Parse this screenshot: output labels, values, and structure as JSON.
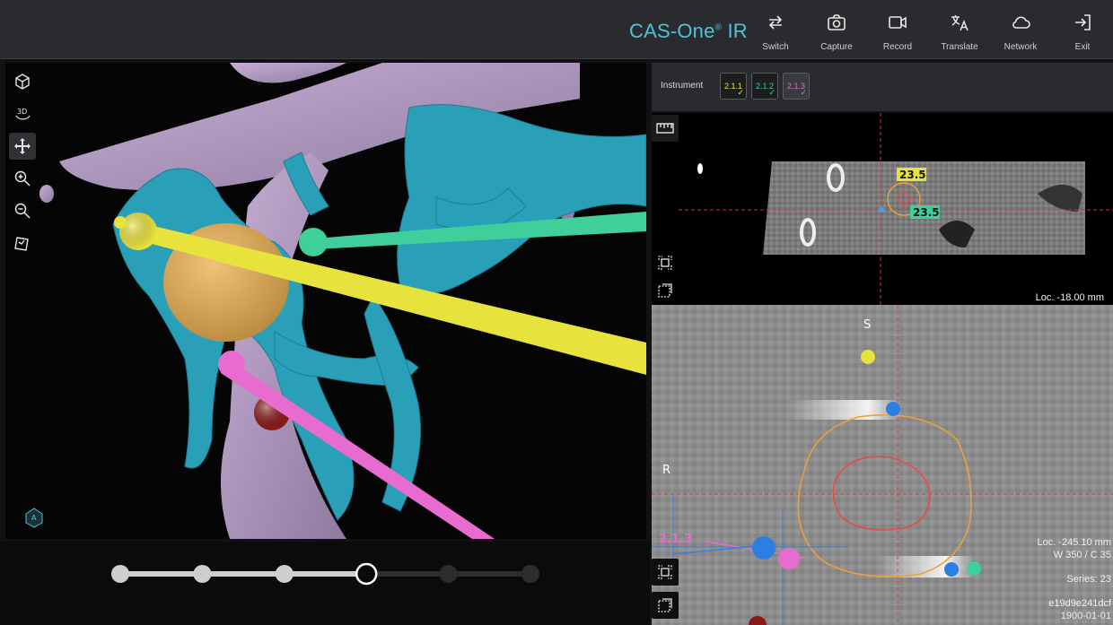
{
  "app": {
    "brand": "CAS-One",
    "brand_suffix": "IR",
    "brand_mark": "®"
  },
  "toolbar": [
    {
      "name": "switch",
      "label": "Switch",
      "icon": "switch-arrows-icon"
    },
    {
      "name": "capture",
      "label": "Capture",
      "icon": "camera-icon"
    },
    {
      "name": "record",
      "label": "Record",
      "icon": "video-camera-icon"
    },
    {
      "name": "translate",
      "label": "Translate",
      "icon": "translate-icon"
    },
    {
      "name": "network",
      "label": "Network",
      "icon": "cloud-icon"
    },
    {
      "name": "exit",
      "label": "Exit",
      "icon": "exit-door-icon"
    }
  ],
  "left_tools": [
    {
      "name": "reset-view",
      "icon": "cube-icon",
      "active": false
    },
    {
      "name": "3d-view",
      "label": "3D",
      "icon": "3d-rotate-icon",
      "active": false
    },
    {
      "name": "pan",
      "icon": "move-arrows-icon",
      "active": true
    },
    {
      "name": "zoom-in",
      "icon": "zoom-in-icon",
      "active": false
    },
    {
      "name": "zoom-out",
      "icon": "zoom-out-icon",
      "active": false
    },
    {
      "name": "screenshot",
      "icon": "snapshot-icon",
      "active": false
    }
  ],
  "timeline": {
    "steps": 6,
    "current_step": 4,
    "completed_steps": 3
  },
  "instrument": {
    "label": "Instrument",
    "items": [
      {
        "id": "2.1.1",
        "color": "#e8e23c",
        "checked": true
      },
      {
        "id": "2.1.2",
        "color": "#3fcf9a",
        "checked": true
      },
      {
        "id": "2.1.3",
        "color": "#e86cd0",
        "checked": true
      }
    ]
  },
  "axial": {
    "label_top": "23.5",
    "label_bottom": "23.5",
    "loc": "Loc. -18.00 mm"
  },
  "coronal": {
    "orient_top": "S",
    "orient_left": "R",
    "needle_label": "2.1.3",
    "loc": "Loc. -245.10 mm",
    "window": "W 350 / C 35",
    "series": "Series: 23",
    "study_id": "e19d9e241dcf",
    "date": "1900-01-01"
  },
  "colors": {
    "accent": "#4fc3dc",
    "needle_yellow": "#e8e23c",
    "needle_green": "#3fcf9a",
    "needle_pink": "#e86cd0",
    "tumor": "#d9a95a",
    "vessels": "#2a9fb8",
    "bone": "#b59ac4"
  }
}
